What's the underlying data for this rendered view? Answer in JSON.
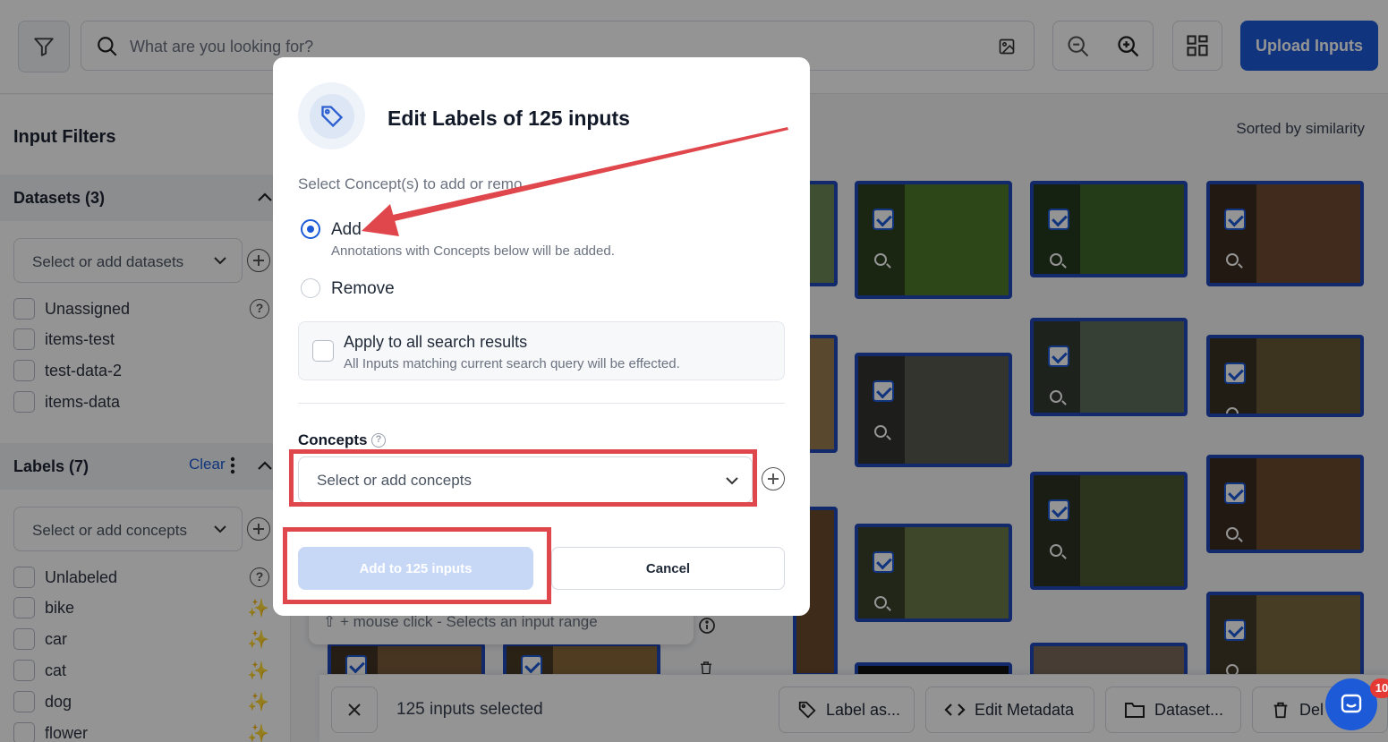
{
  "search": {
    "placeholder": "What are you looking for?"
  },
  "toolbar": {
    "upload_label": "Upload Inputs"
  },
  "sidebar": {
    "title": "Input Filters",
    "datasets": {
      "header": "Datasets (3)",
      "select_placeholder": "Select or add datasets",
      "items": [
        "Unassigned",
        "items-test",
        "test-data-2",
        "items-data"
      ]
    },
    "labels": {
      "header": "Labels (7)",
      "clear_label": "Clear",
      "select_placeholder": "Select or add concepts",
      "items": [
        "Unlabeled",
        "bike",
        "car",
        "cat",
        "dog",
        "flower"
      ]
    }
  },
  "main": {
    "sorted_label": "Sorted by similarity",
    "hint": "⇧ + mouse click - Selects an input range"
  },
  "selection_bar": {
    "count_text": "125 inputs selected",
    "actions": [
      "Label as...",
      "Edit Metadata",
      "Dataset...",
      "Del"
    ]
  },
  "modal": {
    "title": "Edit Labels of 125 inputs",
    "subtitle": "Select Concept(s) to add or remo",
    "add_label": "Add",
    "add_description": "Annotations with Concepts below will be added.",
    "remove_label": "Remove",
    "apply_all_label": "Apply to all search results",
    "apply_all_description": "All Inputs matching current search query will be effected.",
    "concepts_label": "Concepts",
    "concepts_placeholder": "Select or add concepts",
    "submit_label": "Add to 125 inputs",
    "cancel_label": "Cancel"
  },
  "chat": {
    "badge": "10"
  },
  "colors": {
    "accent": "#1d5ad8",
    "annotation_red": "#e0474c",
    "thumb_border": "#1f47b8"
  },
  "icons": [
    "filter-icon",
    "search-icon",
    "image-search-icon",
    "zoom-out-icon",
    "zoom-in-icon",
    "grid-layout-icon",
    "tag-icon",
    "chevron-down-icon",
    "question-icon",
    "wand-icon",
    "close-icon",
    "code-icon",
    "folder-icon",
    "trash-icon",
    "chat-icon"
  ]
}
